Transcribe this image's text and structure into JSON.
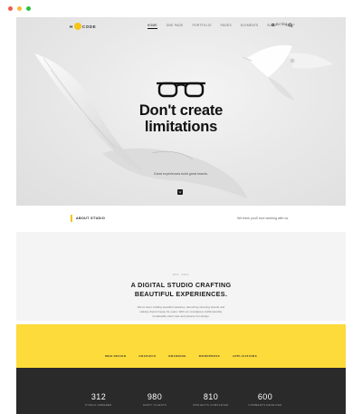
{
  "window": {
    "controls": [
      "close",
      "minimize",
      "maximize"
    ]
  },
  "nav": {
    "logo": {
      "left": "H",
      "right": "CODE"
    },
    "items": [
      {
        "label": "HOME",
        "active": true
      },
      {
        "label": "ONE PAGE",
        "active": false
      },
      {
        "label": "PORTFOLIO",
        "active": false
      },
      {
        "label": "PAGES",
        "active": false
      },
      {
        "label": "ELEMENTS",
        "active": false
      },
      {
        "label": "BLOG",
        "active": false
      },
      {
        "label": "SHOP",
        "active": false
      }
    ],
    "cart_label": "$0 ITEM",
    "search_icon": "search-icon"
  },
  "hero": {
    "title_line1": "Don't create",
    "title_line2": "limitations",
    "subtitle": "Great experiences build great brands.",
    "icon": "glasses-icon",
    "scroll_icon": "chevron-down-icon"
  },
  "about": {
    "label": "ABOUT STUDIO",
    "tagline": "We think you'll love working with us."
  },
  "studio": {
    "est": "EST. 2011",
    "title_line1": "A DIGITAL STUDIO CRAFTING",
    "title_line2": "BEAUTIFUL EXPERIENCES.",
    "text_line1": "We've been crafting beautiful websites, launching stunning brands and",
    "text_line2": "making clients happy for years. With our prestigious craftsmanship,",
    "text_line3": "remarkable client care and passion for design."
  },
  "categories": [
    "WEB DESIGN",
    "GRAPHICS",
    "BRANDING",
    "WORDPRESS",
    "APPLICATIONS"
  ],
  "stats": [
    {
      "value": "312",
      "label": "PIXELS ORDERED"
    },
    {
      "value": "980",
      "label": "HAPPY CLIENTS"
    },
    {
      "value": "810",
      "label": "PROJECTS COMPLETED"
    },
    {
      "value": "600",
      "label": "COMMENTS RECEIVED"
    }
  ],
  "colors": {
    "accent": "#fddb3a",
    "dark": "#2a2a2a",
    "hero_bg": "#e9e9e9"
  }
}
